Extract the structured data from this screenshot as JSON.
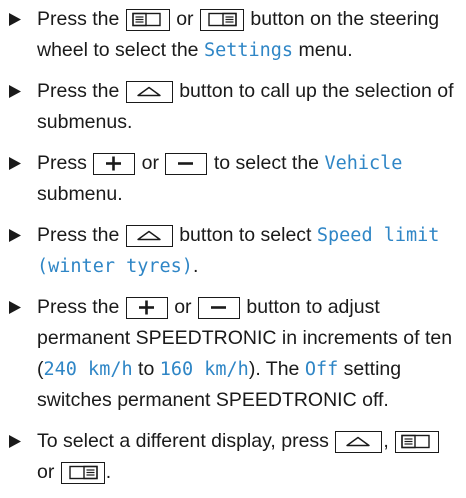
{
  "steps": [
    {
      "parts": [
        {
          "t": "text",
          "v": "Press the "
        },
        {
          "t": "key",
          "k": "display-left"
        },
        {
          "t": "text",
          "v": " or "
        },
        {
          "t": "key",
          "k": "display-right"
        },
        {
          "t": "text",
          "v": " button on the steer­ing wheel to select the "
        },
        {
          "t": "hl",
          "v": "Settings"
        },
        {
          "t": "text",
          "v": " menu."
        }
      ]
    },
    {
      "parts": [
        {
          "t": "text",
          "v": "Press the "
        },
        {
          "t": "key",
          "k": "back"
        },
        {
          "t": "text",
          "v": " button to call up the selec­tion of submenus."
        }
      ]
    },
    {
      "parts": [
        {
          "t": "text",
          "v": "Press "
        },
        {
          "t": "key",
          "k": "plus"
        },
        {
          "t": "text",
          "v": " or "
        },
        {
          "t": "key",
          "k": "minus"
        },
        {
          "t": "text",
          "v": " to select the "
        },
        {
          "t": "hl",
          "v": "Vehicle"
        },
        {
          "t": "text",
          "v": " submenu."
        }
      ]
    },
    {
      "parts": [
        {
          "t": "text",
          "v": "Press the "
        },
        {
          "t": "key",
          "k": "back"
        },
        {
          "t": "text",
          "v": " button to select "
        },
        {
          "t": "hl",
          "v": "Speed limit (winter tyres)"
        },
        {
          "t": "text",
          "v": "."
        }
      ]
    },
    {
      "parts": [
        {
          "t": "text",
          "v": "Press the "
        },
        {
          "t": "key",
          "k": "plus"
        },
        {
          "t": "text",
          "v": " or "
        },
        {
          "t": "key",
          "k": "minus"
        },
        {
          "t": "text",
          "v": " button to adjust permanent SPEEDTRONIC in increments of ten ("
        },
        {
          "t": "hl",
          "v": "240 km/h"
        },
        {
          "t": "text",
          "v": " to "
        },
        {
          "t": "hl",
          "v": "160 km/h"
        },
        {
          "t": "text",
          "v": "). The "
        },
        {
          "t": "hl",
          "v": "Off"
        },
        {
          "t": "text",
          "v": " set­ting switches permanent SPEEDTRONIC off."
        }
      ]
    },
    {
      "parts": [
        {
          "t": "text",
          "v": "To select a different display, press "
        },
        {
          "t": "key",
          "k": "back"
        },
        {
          "t": "text",
          "v": ", "
        },
        {
          "t": "key",
          "k": "display-left"
        },
        {
          "t": "text",
          "v": " or "
        },
        {
          "t": "key",
          "k": "display-right"
        },
        {
          "t": "text",
          "v": "."
        }
      ]
    }
  ],
  "bullet_icon": "triangle-right-icon",
  "keys": {
    "display-left": {
      "icon": "display-left-icon"
    },
    "display-right": {
      "icon": "display-right-icon"
    },
    "back": {
      "icon": "back-arrow-icon"
    },
    "plus": {
      "icon": "plus-icon"
    },
    "minus": {
      "icon": "minus-icon"
    }
  },
  "colors": {
    "text": "#1a1a1a",
    "highlight": "#2f86c6"
  }
}
